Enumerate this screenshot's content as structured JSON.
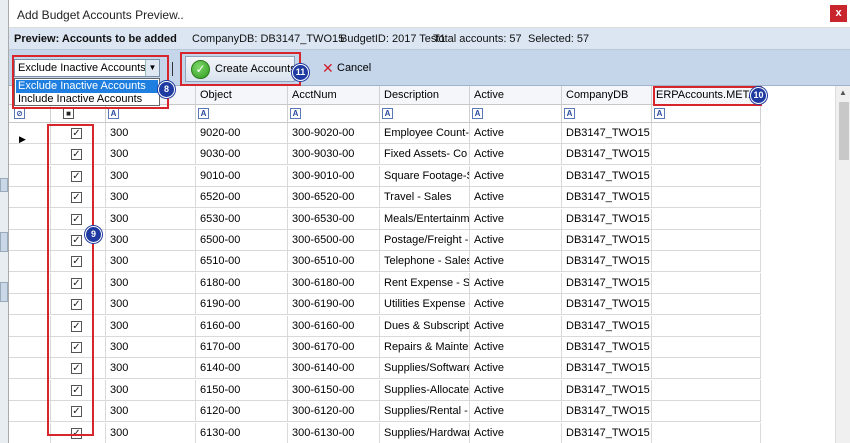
{
  "window": {
    "title": "Add Budget Accounts Preview..",
    "close_glyph": "x"
  },
  "info": {
    "preview_label": "Preview: Accounts to be added",
    "company": "CompanyDB: DB3147_TWO15",
    "budget": "BudgetID: 2017 Test1",
    "total": "Total accounts: 57",
    "selected": "Selected: 57"
  },
  "toolbar": {
    "filter_value": "Exclude Inactive Accounts",
    "filter_options": [
      "Exclude Inactive Accounts",
      "Include Inactive Accounts"
    ],
    "separator": "|",
    "create_label": "Create Accounts",
    "cancel_label": "Cancel"
  },
  "grid": {
    "columns": [
      "",
      "",
      "Object",
      "AcctNum",
      "Description",
      "Active",
      "CompanyDB",
      "ERPAccounts.META1"
    ],
    "rows": [
      {
        "b": "300",
        "object": "9020-00",
        "acct": "300-9020-00",
        "desc": "Employee Count-",
        "active": "Active",
        "company": "DB3147_TWO15"
      },
      {
        "b": "300",
        "object": "9030-00",
        "acct": "300-9030-00",
        "desc": "Fixed Assets- Co",
        "active": "Active",
        "company": "DB3147_TWO15"
      },
      {
        "b": "300",
        "object": "9010-00",
        "acct": "300-9010-00",
        "desc": "Square Footage-S",
        "active": "Active",
        "company": "DB3147_TWO15"
      },
      {
        "b": "300",
        "object": "6520-00",
        "acct": "300-6520-00",
        "desc": "Travel - Sales",
        "active": "Active",
        "company": "DB3147_TWO15"
      },
      {
        "b": "300",
        "object": "6530-00",
        "acct": "300-6530-00",
        "desc": "Meals/Entertainm",
        "active": "Active",
        "company": "DB3147_TWO15"
      },
      {
        "b": "300",
        "object": "6500-00",
        "acct": "300-6500-00",
        "desc": "Postage/Freight -",
        "active": "Active",
        "company": "DB3147_TWO15"
      },
      {
        "b": "300",
        "object": "6510-00",
        "acct": "300-6510-00",
        "desc": "Telephone - Sales",
        "active": "Active",
        "company": "DB3147_TWO15"
      },
      {
        "b": "300",
        "object": "6180-00",
        "acct": "300-6180-00",
        "desc": "Rent Expense - S",
        "active": "Active",
        "company": "DB3147_TWO15"
      },
      {
        "b": "300",
        "object": "6190-00",
        "acct": "300-6190-00",
        "desc": "Utilities Expense -",
        "active": "Active",
        "company": "DB3147_TWO15"
      },
      {
        "b": "300",
        "object": "6160-00",
        "acct": "300-6160-00",
        "desc": "Dues & Subscripti",
        "active": "Active",
        "company": "DB3147_TWO15"
      },
      {
        "b": "300",
        "object": "6170-00",
        "acct": "300-6170-00",
        "desc": "Repairs & Mainte",
        "active": "Active",
        "company": "DB3147_TWO15"
      },
      {
        "b": "300",
        "object": "6140-00",
        "acct": "300-6140-00",
        "desc": "Supplies/Software",
        "active": "Active",
        "company": "DB3147_TWO15"
      },
      {
        "b": "300",
        "object": "6150-00",
        "acct": "300-6150-00",
        "desc": "Supplies-Allocate",
        "active": "Active",
        "company": "DB3147_TWO15"
      },
      {
        "b": "300",
        "object": "6120-00",
        "acct": "300-6120-00",
        "desc": "Supplies/Rental -",
        "active": "Active",
        "company": "DB3147_TWO15"
      },
      {
        "b": "300",
        "object": "6130-00",
        "acct": "300-6130-00",
        "desc": "Supplies/Hardwar",
        "active": "Active",
        "company": "DB3147_TWO15"
      }
    ]
  },
  "callouts": {
    "c8": "8",
    "c9": "9",
    "c10": "10",
    "c11": "11"
  },
  "colors": {
    "accent_red": "#d6262c",
    "callout_blue": "#1f3aa0",
    "toolbar_blue": "#c5d6ea",
    "selection_blue": "#1e7fe0"
  }
}
